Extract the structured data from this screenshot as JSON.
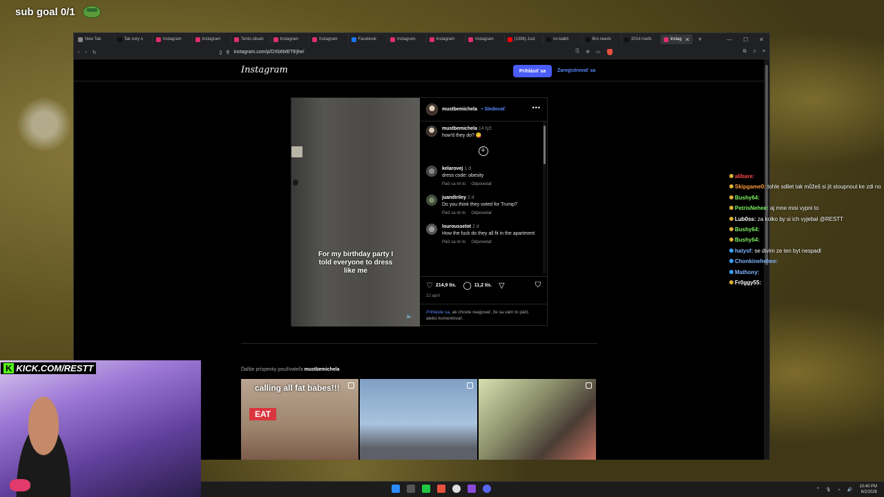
{
  "overlay": {
    "sub_goal": "sub goal 0/1"
  },
  "browser": {
    "tabs": [
      {
        "label": "New Tab",
        "color": "#888888"
      },
      {
        "label": "Tak sory n",
        "color": "#111111"
      },
      {
        "label": "Instagram",
        "color": "#e1306c"
      },
      {
        "label": "Instagram",
        "color": "#e1306c"
      },
      {
        "label": "Tento obsah",
        "color": "#e1306c"
      },
      {
        "label": "Instagram",
        "color": "#e1306c"
      },
      {
        "label": "Instagram",
        "color": "#e1306c"
      },
      {
        "label": "Facebook",
        "color": "#1877f2"
      },
      {
        "label": "Instagram",
        "color": "#e1306c"
      },
      {
        "label": "Instagram",
        "color": "#e1306c"
      },
      {
        "label": "Instagram",
        "color": "#e1306c"
      },
      {
        "label": "(1398) Just",
        "color": "#ff0000"
      },
      {
        "label": "no kalbš",
        "color": "#111111"
      },
      {
        "label": "Bro needs",
        "color": "#111111"
      },
      {
        "label": "2014 mačk",
        "color": "#111111"
      },
      {
        "label": "Instag",
        "color": "#e1306c"
      }
    ],
    "url": "instagram.com/p/DXb6METEjhe/"
  },
  "instagram": {
    "logo": "Instagram",
    "login_label": "Prihlásiť sa",
    "signup_label": "Zaregistrovať sa",
    "post": {
      "video_caption": "For my birthday party I told everyone to dress like me",
      "author": "mustbemichela",
      "follow_label": "• Sledovať",
      "caption_user": "mustbemichela",
      "caption_time": "14 týž.",
      "caption_text": "how'd they do? 😋",
      "like_label": "Páči sa mi to",
      "reply_label": "Odpovedať",
      "comments": [
        {
          "user": "kelarovej",
          "time": "1 d",
          "text": "dress code: obesity"
        },
        {
          "user": "juandiriley",
          "time": "2 d",
          "text": "Do you think they voted for Trump?"
        },
        {
          "user": "lourousselot",
          "time": "2 d",
          "text": "How the fuck do they all fit in the apartment"
        }
      ],
      "likes": "214,9 tis.",
      "comment_count": "11,2 tis.",
      "date": "22 apríl",
      "login_prompt_link": "Prihláste sa,",
      "login_prompt_text": " ak chcete reagovať, že sa vám to páči, alebo komentovať."
    },
    "more_posts_prefix": "Ďalšie príspevky používateľa ",
    "more_posts_user": "mustbemichela",
    "thumb1_text": "calling all fat babes!!!",
    "thumb1_sign": "EAT"
  },
  "chat": [
    {
      "user": "alibare:",
      "msg": "",
      "color": "red"
    },
    {
      "user": "Skipgame0:",
      "msg": " tohle sdilet tak můžeš si jit stoupnout ke zdi no",
      "color": "orange"
    },
    {
      "user": "Bushy64:",
      "msg": "",
      "color": "green"
    },
    {
      "user": "PetrisNehee:",
      "msg": " aj mne misi vypni to",
      "color": "green"
    },
    {
      "user": "Lub0ss:",
      "msg": " za kolko by si ich vyjebal @RESTT",
      "color": "white"
    },
    {
      "user": "Bushy64:",
      "msg": "",
      "color": "green"
    },
    {
      "user": "Bushy64:",
      "msg": "",
      "color": "green"
    },
    {
      "user": "hatysf:",
      "msg": " se divim ze ten byt nespadl",
      "color": "blue"
    },
    {
      "user": "Chonkinehehee:",
      "msg": "",
      "color": "blue"
    },
    {
      "user": "Mathony:",
      "msg": "",
      "color": "blue"
    },
    {
      "user": "Fr0ggy55:",
      "msg": "",
      "color": "white"
    }
  ],
  "stream": {
    "kick_url": "KICK.COM/RESTT",
    "kick_badge": "K"
  },
  "taskbar": {
    "time": "10:40 PM",
    "date": "8/2/2026"
  }
}
